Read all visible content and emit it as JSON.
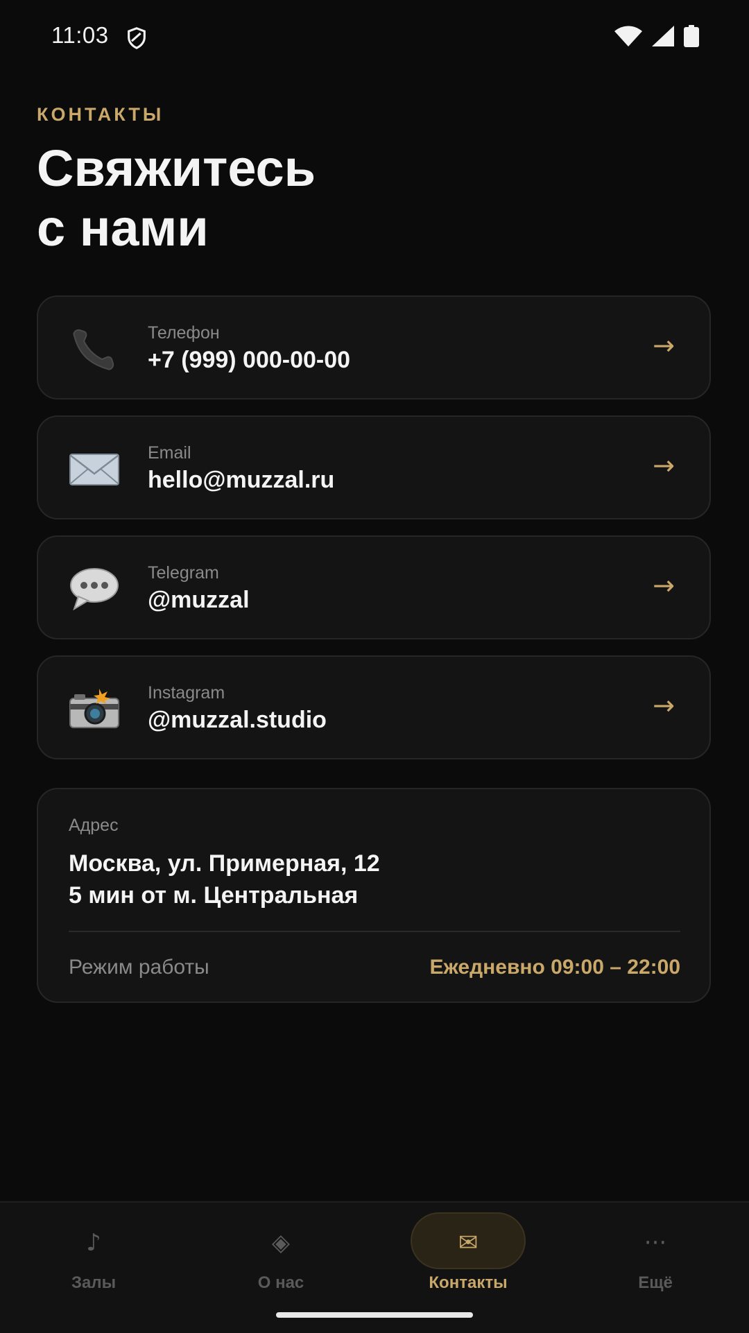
{
  "status_bar": {
    "time": "11:03",
    "icons": [
      "shield-icon",
      "wifi-icon",
      "signal-icon",
      "battery-icon"
    ]
  },
  "header": {
    "section_label": "КОНТАКТЫ",
    "title_line1": "Свяжитесь",
    "title_line2": "с нами"
  },
  "contacts": [
    {
      "icon": "phone-icon",
      "label": "Телефон",
      "value": "+7 (999) 000-00-00",
      "arrow": "→"
    },
    {
      "icon": "envelope-icon",
      "label": "Email",
      "value": "hello@muzzal.ru",
      "arrow": "→"
    },
    {
      "icon": "speech-bubble-icon",
      "label": "Telegram",
      "value": "@muzzal",
      "arrow": "→"
    },
    {
      "icon": "camera-icon",
      "label": "Instagram",
      "value": "@muzzal.studio",
      "arrow": "→"
    }
  ],
  "address": {
    "label": "Адрес",
    "line1": "Москва, ул. Примерная, 12",
    "line2": "5 мин от м. Центральная",
    "hours_label": "Режим работы",
    "hours_value": "Ежедневно 09:00 – 22:00"
  },
  "bottom_nav": {
    "items": [
      {
        "icon": "music-note-icon",
        "glyph": "♪",
        "label": "Залы",
        "active": false
      },
      {
        "icon": "diamond-icon",
        "glyph": "◈",
        "label": "О нас",
        "active": false
      },
      {
        "icon": "mail-icon",
        "glyph": "✉",
        "label": "Контакты",
        "active": true
      },
      {
        "icon": "more-icon",
        "glyph": "···",
        "label": "Ещё",
        "active": false
      }
    ]
  },
  "colors": {
    "background": "#0b0b0b",
    "card": "#141414",
    "accent": "#c9a86a",
    "muted": "#8a8a8a"
  }
}
